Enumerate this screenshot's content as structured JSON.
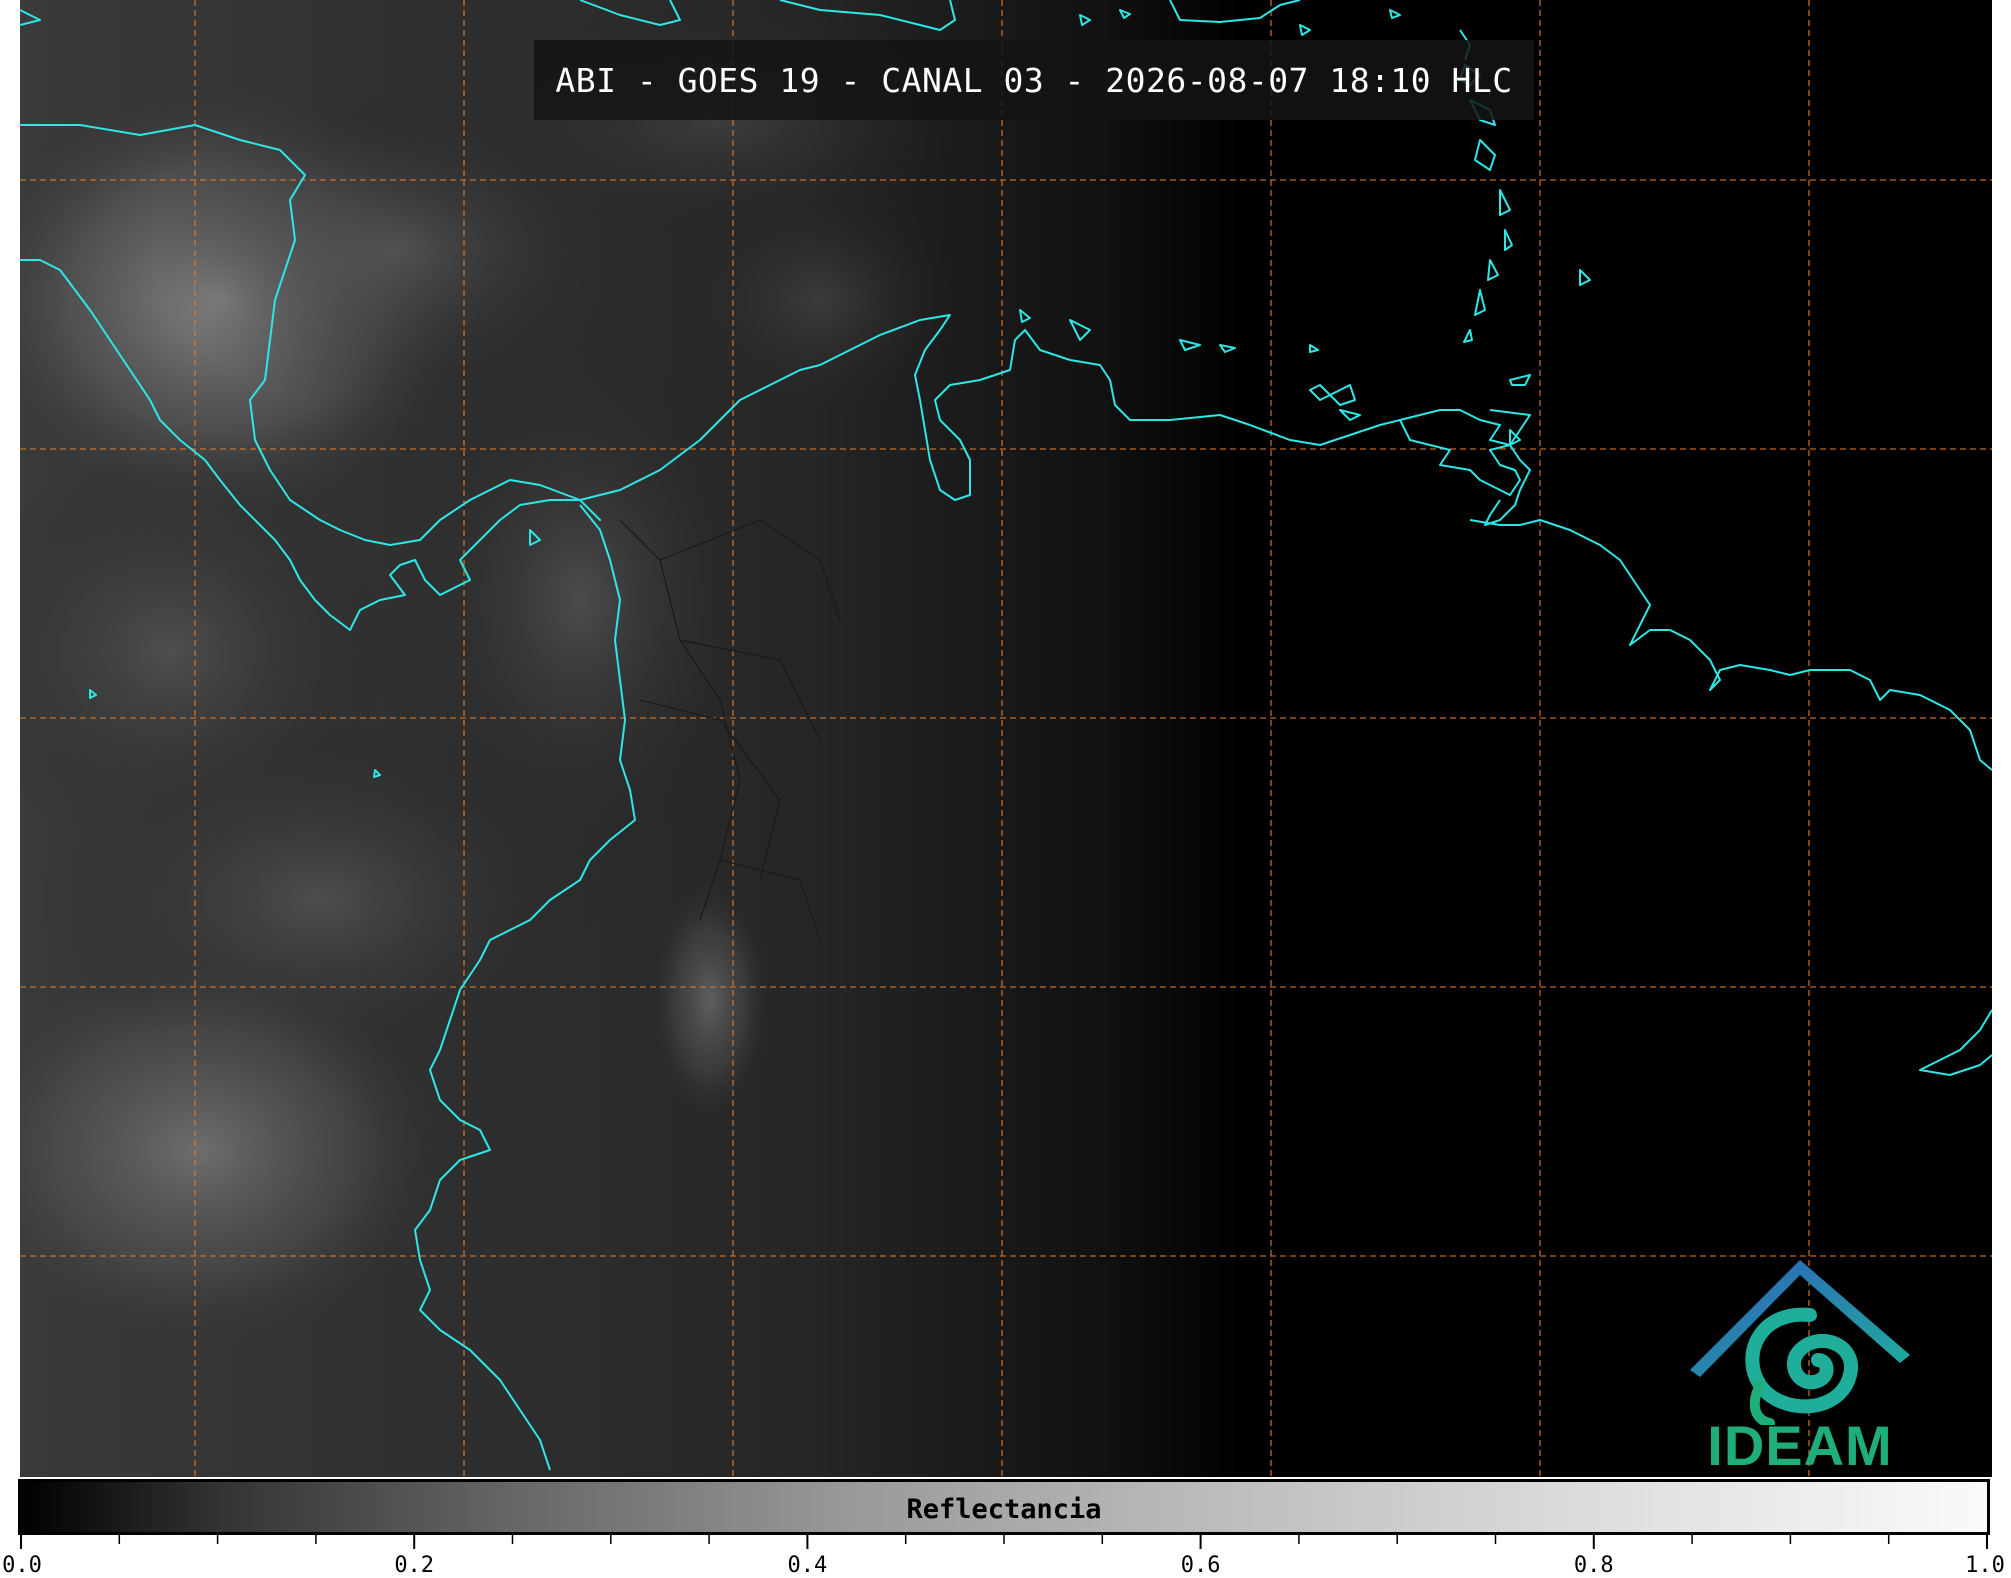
{
  "title": "ABI - GOES 19 - CANAL 03 - 2026-08-07 18:10 HLC",
  "colors": {
    "coastline": "#2ee6e6",
    "grid": "#e07a2a",
    "background": "#000000",
    "logo_text": "#1fae7a",
    "logo_roof": "#2f7fbf",
    "logo_swirl": "#1fae7a"
  },
  "logo": {
    "text": "IDEAM",
    "icon": "ideam-swirl-logo"
  },
  "colorbar": {
    "label": "Reflectancia",
    "min": 0.0,
    "max": 1.0,
    "tick_labels": [
      "0.0",
      "0.2",
      "0.4",
      "0.6",
      "0.8",
      "1.0"
    ],
    "tick_values": [
      0.0,
      0.2,
      0.4,
      0.6,
      0.8,
      1.0
    ],
    "minor_step": 0.05
  }
}
